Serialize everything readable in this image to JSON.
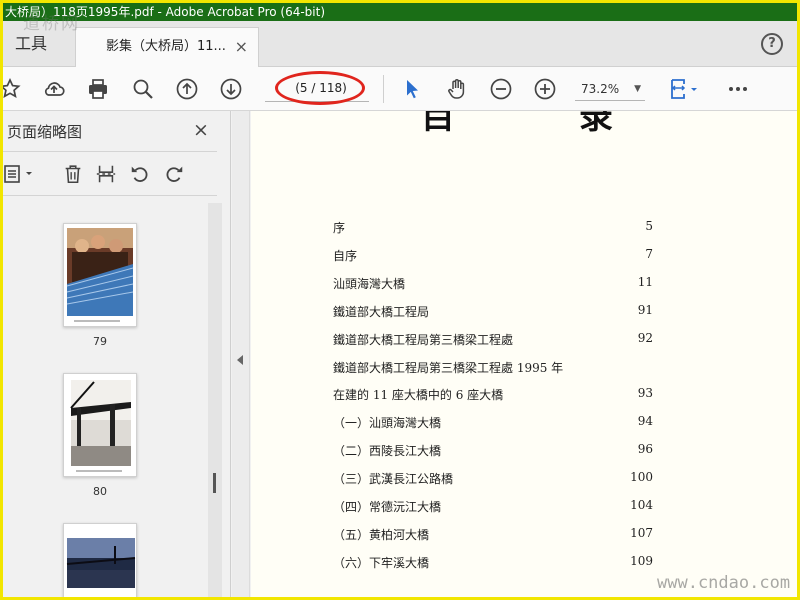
{
  "window": {
    "title": "大桥局）118页1995年.pdf - Adobe Acrobat Pro (64-bit)",
    "watermark_top": "道桥网",
    "watermark_bottom": "www.cndao.com"
  },
  "tabs": {
    "tools_label": "工具",
    "document_label": "影集（大桥局）11...",
    "document_close": "×",
    "help": "?"
  },
  "toolbar": {
    "page_indicator": "(5 / 118)",
    "zoom_value": "73.2%",
    "icons": [
      "bookmark-star-icon",
      "upload-icon",
      "print-icon",
      "search-zoom-icon",
      "page-up-icon",
      "page-down-icon",
      "select-pointer-icon",
      "hand-icon",
      "zoom-out-icon",
      "zoom-in-icon",
      "page-fit-icon",
      "more-icon"
    ]
  },
  "colors": {
    "titlebar": "#1a6e16",
    "accent_blue": "#2c6fce",
    "annotation_red": "#e0251d",
    "frame_yellow": "#f2e600"
  },
  "left_panel": {
    "title": "页面缩略图",
    "close": "×",
    "thumbnails": [
      {
        "label": "79"
      },
      {
        "label": "80"
      },
      {
        "label": ""
      }
    ]
  },
  "document": {
    "heading": "目 录",
    "toc": [
      {
        "title": "序",
        "page": "5"
      },
      {
        "title": "自序",
        "page": "7"
      },
      {
        "title": "汕頭海灣大橋",
        "page": "11"
      },
      {
        "title": "鐵道部大橋工程局",
        "page": "91"
      },
      {
        "title": "鐵道部大橋工程局第三橋梁工程處",
        "page": "92"
      },
      {
        "title": "鐵道部大橋工程局第三橋梁工程處 1995 年",
        "page": ""
      },
      {
        "title": "在建的 11 座大橋中的 6 座大橋",
        "page": "93"
      },
      {
        "title": "（一）汕頭海灣大橋",
        "page": "94"
      },
      {
        "title": "（二）西陵長江大橋",
        "page": "96"
      },
      {
        "title": "（三）武漢長江公路橋",
        "page": "100"
      },
      {
        "title": "（四）常德沅江大橋",
        "page": "104"
      },
      {
        "title": "（五）黄柏河大橋",
        "page": "107"
      },
      {
        "title": "（六）下牢溪大橋",
        "page": "109"
      }
    ]
  }
}
